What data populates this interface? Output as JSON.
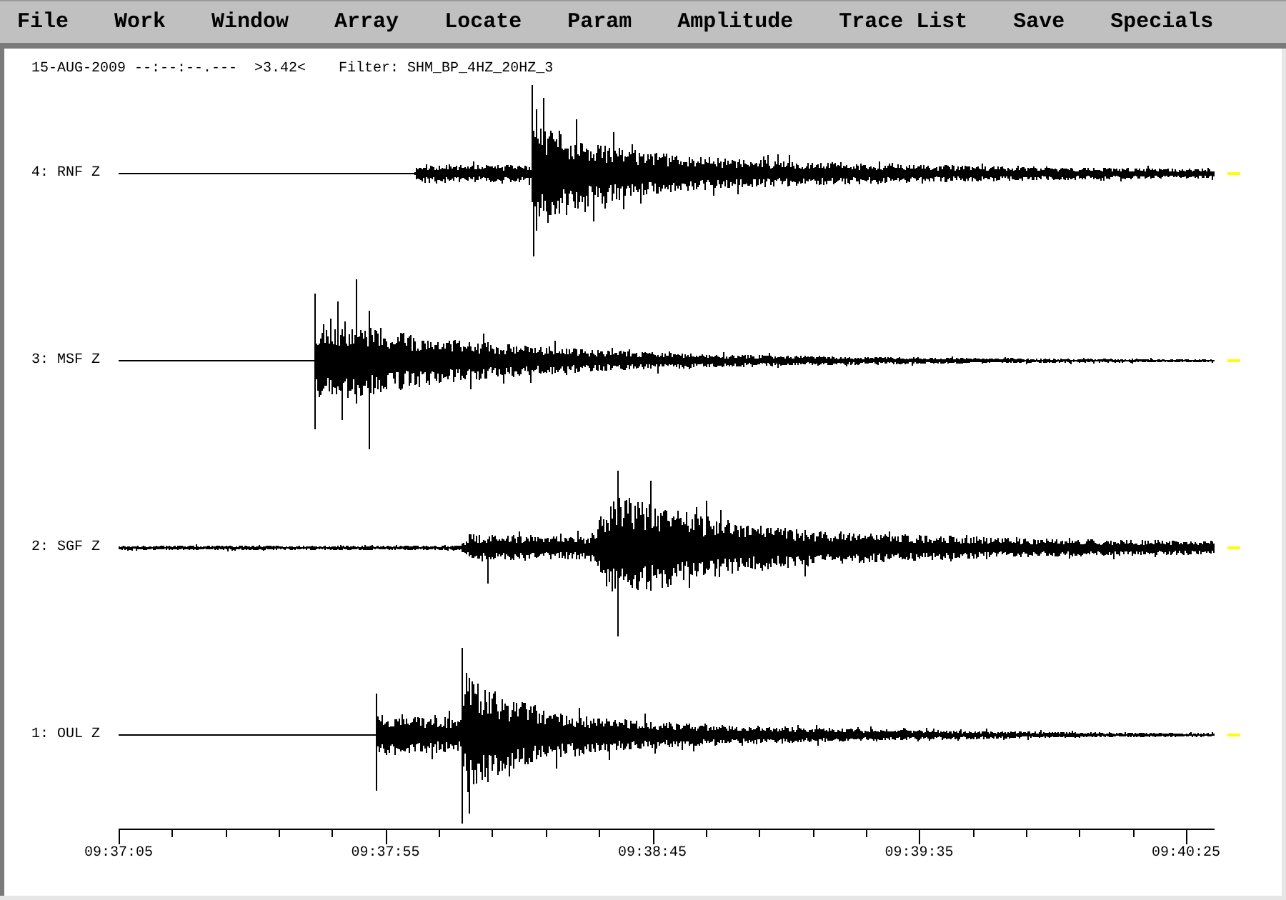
{
  "menu_bar": {
    "items": [
      "File",
      "Work",
      "Window",
      "Array",
      "Locate",
      "Param",
      "Amplitude",
      "Trace List",
      "Save",
      "Specials"
    ]
  },
  "header": {
    "date_time": "15-AUG-2009 --:--:--.---",
    "value": ">3.42<",
    "filter": "Filter: SHM_BP_4HZ_20HZ_3"
  },
  "traces": [
    {
      "label": "4: RNF Z"
    },
    {
      "label": "3: MSF Z"
    },
    {
      "label": "2: SGF Z"
    },
    {
      "label": "1: OUL Z"
    }
  ],
  "time_axis": {
    "labels": [
      "09:37:05",
      "09:37:55",
      "09:38:45",
      "09:39:35",
      "09:40:25"
    ]
  }
}
